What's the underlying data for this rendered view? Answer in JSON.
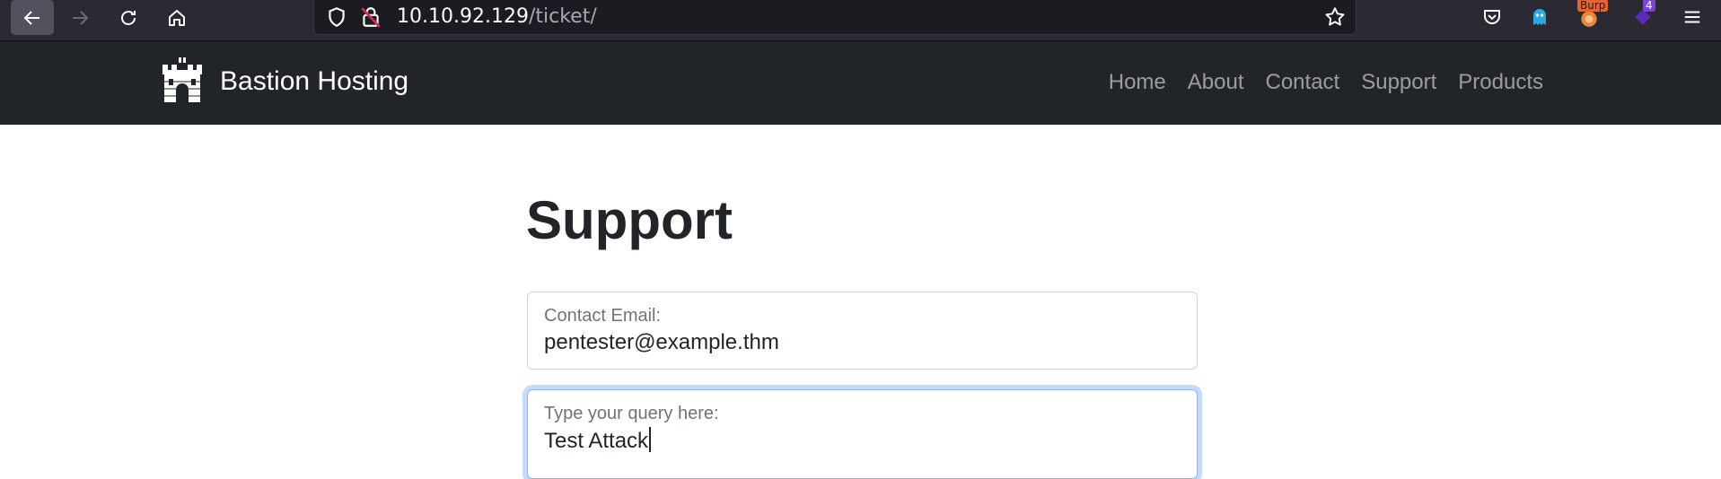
{
  "browser": {
    "url_host": "10.10.92.129",
    "url_path": "/ticket/",
    "icons": [
      "back-arrow-icon",
      "forward-arrow-icon",
      "reload-icon",
      "home-icon",
      "shield-icon",
      "insecure-lock-icon",
      "bookmark-star-icon",
      "pocket-icon",
      "ghost-extension-icon",
      "burp-extension-icon",
      "purple-extension-icon",
      "menu-icon"
    ],
    "burp_badge": "Burp",
    "extension_badge": "4"
  },
  "navbar": {
    "brand": "Bastion Hosting",
    "links": [
      "Home",
      "About",
      "Contact",
      "Support",
      "Products"
    ]
  },
  "main": {
    "title": "Support",
    "email_field": {
      "label": "Contact Email:",
      "value": "pentester@example.thm"
    },
    "query_field": {
      "label": "Type your query here:",
      "value": "Test Attack"
    }
  },
  "colors": {
    "toolbar_bg": "#2b2a33",
    "navbar_bg": "#212529",
    "focus_ring": "#86b7fe"
  }
}
